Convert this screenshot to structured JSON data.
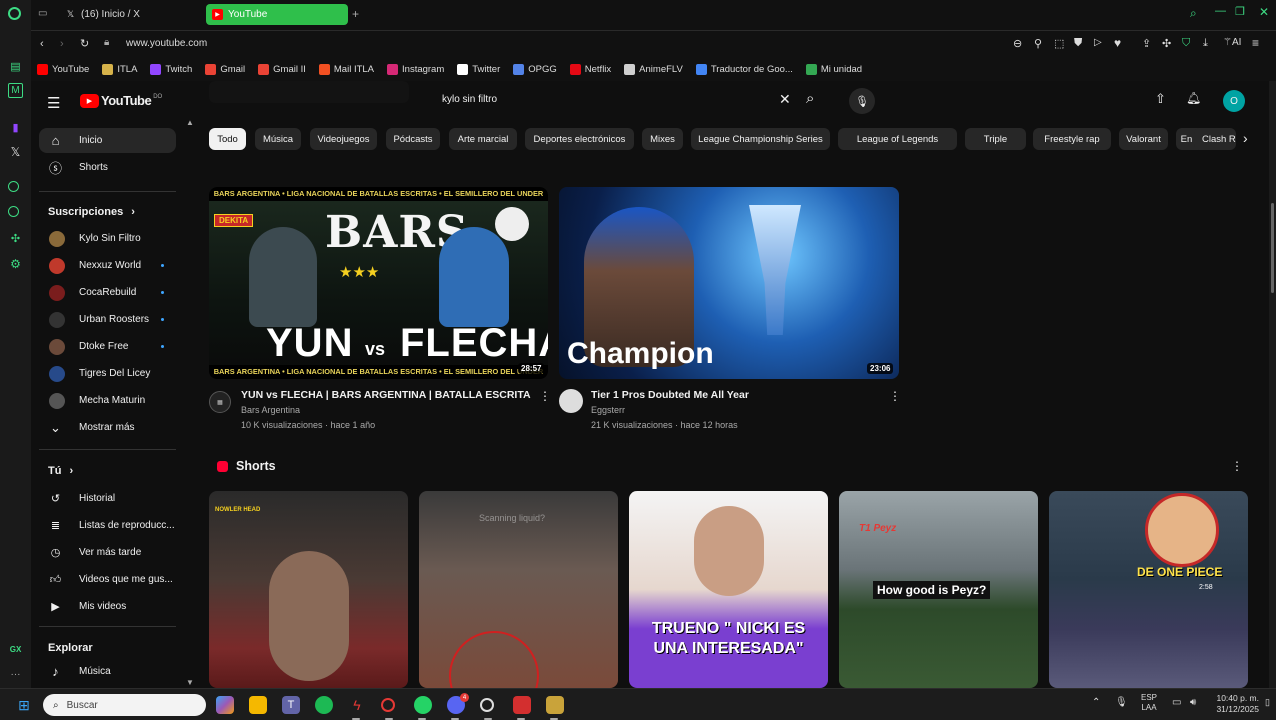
{
  "browser": {
    "tabs": [
      {
        "label": "(16) Inicio / X",
        "icon": "x-logo-icon",
        "active": false
      },
      {
        "label": "YouTube",
        "icon": "youtube-favicon-icon",
        "active": true
      }
    ],
    "url": "www.youtube.com",
    "ai_label": "AI",
    "bookmarks": [
      {
        "label": "YouTube",
        "color": "#ff0000"
      },
      {
        "label": "ITLA",
        "color": "#d6b24a"
      },
      {
        "label": "Twitch",
        "color": "#9146ff"
      },
      {
        "label": "Gmail",
        "color": "#ea4335"
      },
      {
        "label": "Gmail II",
        "color": "#ea4335"
      },
      {
        "label": "Mail ITLA",
        "color": "#f25022"
      },
      {
        "label": "Instagram",
        "color": "#d62976"
      },
      {
        "label": "Twitter",
        "color": "#ffffff"
      },
      {
        "label": "OPGG",
        "color": "#5383e8"
      },
      {
        "label": "Netflix",
        "color": "#e50914"
      },
      {
        "label": "AnimeFLV",
        "color": "#cfcfcf"
      },
      {
        "label": "Traductor de Goo...",
        "color": "#4285f4"
      },
      {
        "label": "Mi unidad",
        "color": "#34a853"
      }
    ]
  },
  "youtube": {
    "logo_text": "YouTube",
    "country_code": "DO",
    "search_value": "kylo sin filtro",
    "avatar_letter": "O",
    "sidebar": {
      "main": [
        {
          "label": "Inicio",
          "icon": "home-icon",
          "active": true
        },
        {
          "label": "Shorts",
          "icon": "shorts-icon",
          "active": false
        }
      ],
      "subscriptions_title": "Suscripciones",
      "subscriptions": [
        {
          "label": "Kylo Sin Filtro",
          "color": "#8a6a3a",
          "dot": false
        },
        {
          "label": "Nexxuz World",
          "color": "#c0392b",
          "dot": true
        },
        {
          "label": "CocaRebuild",
          "color": "#7a1d1d",
          "dot": true
        },
        {
          "label": "Urban Roosters",
          "color": "#333333",
          "dot": true
        },
        {
          "label": "Dtoke Free",
          "color": "#6b4a3a",
          "dot": true
        },
        {
          "label": "Tigres Del Licey",
          "color": "#274a8a",
          "dot": false
        },
        {
          "label": "Mecha Maturin",
          "color": "#555555",
          "dot": false
        }
      ],
      "show_more": "Mostrar más",
      "you_title": "Tú",
      "you_items": [
        {
          "label": "Historial",
          "icon": "history-icon"
        },
        {
          "label": "Listas de reproducc...",
          "icon": "playlists-icon"
        },
        {
          "label": "Ver más tarde",
          "icon": "watch-later-icon"
        },
        {
          "label": "Videos que me gus...",
          "icon": "like-icon"
        },
        {
          "label": "Mis videos",
          "icon": "my-videos-icon"
        }
      ],
      "explore_title": "Explorar",
      "explore_items": [
        {
          "label": "Música",
          "icon": "music-icon"
        }
      ]
    },
    "chips": [
      "Todo",
      "Música",
      "Videojuegos",
      "Pódcasts",
      "Arte marcial",
      "Deportes electrónicos",
      "Mixes",
      "League Championship Series",
      "League of Legends",
      "Triple",
      "Freestyle rap",
      "Valorant",
      "En directo",
      "Clash R"
    ],
    "videos": [
      {
        "title": "YUN vs FLECHA | BARS ARGENTINA | BATALLA ESCRITA",
        "channel": "Bars Argentina",
        "meta": "10 K visualizaciones · hace 1 año",
        "duration": "28:57",
        "thumb_top_text": "BARS ARGENTINA • LIGA NACIONAL DE BATALLAS ESCRITAS • EL SEMILLERO DEL UNDER",
        "thumb_bottom_text": "BARS ARGENTINA • LIGA NACIONAL DE BATALLAS ESCRITAS • EL SEMILLERO DEL UNDER",
        "thumb_logo": "BARS",
        "thumb_left_name": "YUN",
        "thumb_vs": "vs",
        "thumb_right_name": "FLECHA",
        "thumb_badge": "DEKITA",
        "thumb_stars": "★★★"
      },
      {
        "title": "Tier 1 Pros Doubted Me All Year",
        "channel": "Eggsterr",
        "meta": "21 K visualizaciones · hace 12 horas",
        "duration": "23:06",
        "thumb_text": "Champion"
      }
    ],
    "shorts_title": "Shorts",
    "shorts": [
      {
        "caption": "NOWLER HEAD"
      },
      {
        "caption": "Scanning liquid?"
      },
      {
        "caption": "TRUENO \" NICKI ES UNA INTERESADA\""
      },
      {
        "caption": "How good is Peyz?",
        "tag": "T1 Peyz"
      },
      {
        "caption": "DE ONE PIECE",
        "duration": "2:58"
      }
    ]
  },
  "taskbar": {
    "search_placeholder": "Buscar",
    "lang_top": "ESP",
    "lang_bottom": "LAA",
    "time": "10:40 p. m.",
    "date": "31/12/2025",
    "discord_badge": "4"
  }
}
